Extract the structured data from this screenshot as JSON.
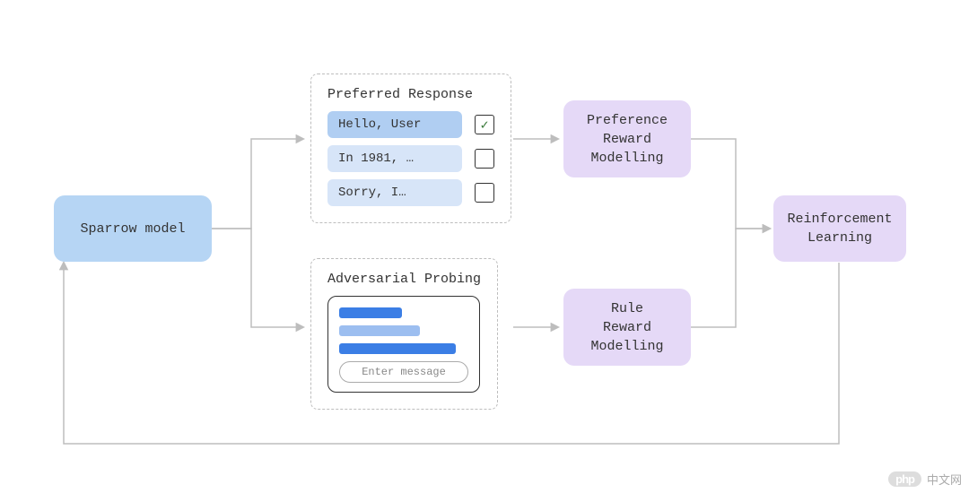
{
  "nodes": {
    "sparrow": "Sparrow model",
    "pref_reward": "Preference\nReward\nModelling",
    "rule_reward": "Rule\nReward\nModelling",
    "rl": "Reinforcement\nLearning"
  },
  "preferred": {
    "title": "Preferred Response",
    "options": [
      {
        "label": "Hello, User",
        "selected": true
      },
      {
        "label": "In 1981, …",
        "selected": false
      },
      {
        "label": "Sorry, I…",
        "selected": false
      }
    ]
  },
  "adversarial": {
    "title": "Adversarial Probing",
    "placeholder": "Enter message"
  },
  "watermark": {
    "brand": "php",
    "text": "中文网"
  },
  "colors": {
    "blue": "#b6d5f4",
    "purple": "#e5d9f7",
    "connector": "#bdbdbd",
    "bar_dark": "#3b7ee5",
    "bar_light": "#9cbef0"
  }
}
